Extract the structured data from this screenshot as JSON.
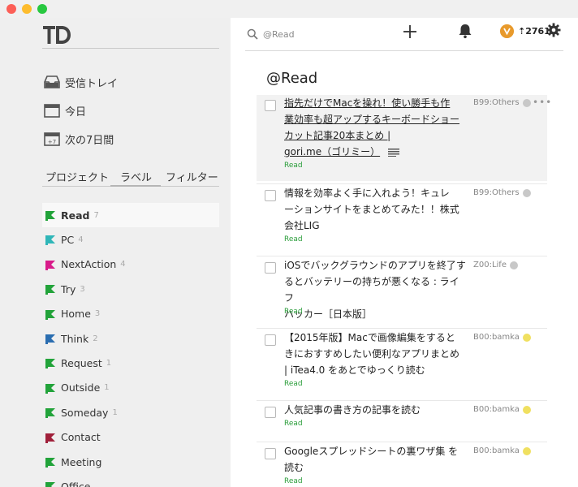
{
  "sidebar": {
    "nav": [
      {
        "label": "受信トレイ",
        "icon": "inbox-icon"
      },
      {
        "label": "今日",
        "icon": "calendar-today-icon"
      },
      {
        "label": "次の7日間",
        "icon": "calendar-week-icon",
        "icon_text": "+7"
      }
    ],
    "tabs": {
      "project": "プロジェクト",
      "label": "ラベル",
      "filter": "フィルター",
      "active": "label"
    },
    "labels": [
      {
        "name": "Read",
        "count": "7",
        "color": "#22a33a",
        "active": true
      },
      {
        "name": "PC",
        "count": "4",
        "color": "#2fb6b8"
      },
      {
        "name": "NextAction",
        "count": "4",
        "color": "#d81b8a"
      },
      {
        "name": "Try",
        "count": "3",
        "color": "#22a33a"
      },
      {
        "name": "Home",
        "count": "3",
        "color": "#22a33a"
      },
      {
        "name": "Think",
        "count": "2",
        "color": "#2a6db0"
      },
      {
        "name": "Request",
        "count": "1",
        "color": "#22a33a"
      },
      {
        "name": "Outside",
        "count": "1",
        "color": "#22a33a"
      },
      {
        "name": "Someday",
        "count": "1",
        "color": "#22a33a"
      },
      {
        "name": "Contact",
        "count": "",
        "color": "#a0203a"
      },
      {
        "name": "Meeting",
        "count": "",
        "color": "#22a33a"
      },
      {
        "name": "Office",
        "count": "",
        "color": "#22a33a"
      }
    ]
  },
  "topbar": {
    "search_placeholder": "@Read",
    "karma": "⇡2761",
    "icons": [
      "search-icon",
      "plus-icon",
      "bell-icon",
      "karma-badge-icon",
      "gear-icon"
    ]
  },
  "main": {
    "title": "@Read",
    "tasks": [
      {
        "lines": [
          "指先だけでMacを操れ！使い勝手も作",
          "業効率も超アップするキーボードショー",
          "カット記事20本まとめ |",
          "gori.me（ゴリミー）"
        ],
        "label": "Read",
        "project": "B99:Others",
        "dot_color": "#c8c8c8",
        "hover": true,
        "note": true
      },
      {
        "lines": [
          "情報を効率よく手に入れよう！キュレ",
          "ーションサイトをまとめてみた！！株式",
          "会社LIG"
        ],
        "label": "Read",
        "project": "B99:Others",
        "dot_color": "#c8c8c8"
      },
      {
        "lines": [
          "iOSでバックグラウンドのアプリを終了す",
          "るとバッテリーの持ちが悪くなる : ライフ",
          "ハッカー［日本版］"
        ],
        "label": "Read",
        "project": "Z00:Life",
        "dot_color": "#c8c8c8"
      },
      {
        "lines": [
          "【2015年版】Macで画像編集をすると",
          "きにおすすめしたい便利なアプリまとめ",
          "| iTea4.0 をあとでゆっくり読む"
        ],
        "label": "Read",
        "project": "B00:bamka",
        "dot_color": "#f0e060"
      },
      {
        "lines": [
          "人気記事の書き方の記事を読む"
        ],
        "label": "Read",
        "project": "B00:bamka",
        "dot_color": "#f0e060"
      },
      {
        "lines": [
          "Googleスプレッドシートの裏ワザ集 を",
          "読む"
        ],
        "label": "Read",
        "project": "B00:bamka",
        "dot_color": "#f0e060"
      }
    ]
  }
}
